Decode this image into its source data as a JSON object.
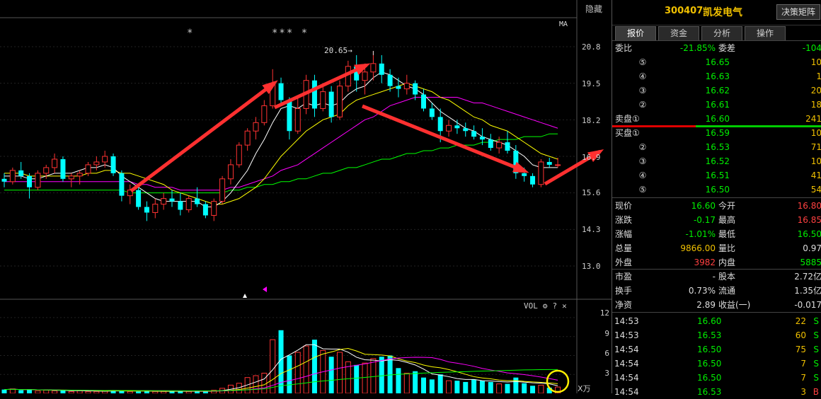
{
  "chart": {
    "hide_label": "隐藏",
    "ma_label": "MA",
    "high_label": "20.65→",
    "stars": [
      "*",
      "*** *"
    ],
    "price_ticks": [
      "20.8",
      "19.5",
      "18.2",
      "16.9",
      "15.6",
      "14.3",
      "13.0"
    ],
    "vol_toolbar": {
      "label": "VOL",
      "settings_icon": "gear-icon",
      "help": "?",
      "close": "✕"
    },
    "vol_ticks": [
      "12",
      "9",
      "6",
      "3"
    ],
    "vol_unit": "X万",
    "colors": {
      "up": "#ff3232",
      "down": "#00ffff",
      "ma5": "#ffffff",
      "ma10": "#ffff00",
      "ma20": "#ff00ff",
      "ma60": "#00ff00",
      "arrow": "#ff3030"
    }
  },
  "chart_data": {
    "type": "candlestick",
    "ylim": [
      13.0,
      20.8
    ],
    "candles": [
      [
        16.1,
        16.3,
        15.8,
        16.0
      ],
      [
        16.0,
        16.5,
        15.9,
        16.4
      ],
      [
        16.4,
        16.7,
        16.1,
        16.2
      ],
      [
        16.2,
        16.3,
        15.4,
        15.8
      ],
      [
        15.8,
        16.4,
        15.7,
        16.3
      ],
      [
        16.3,
        16.6,
        16.1,
        16.5
      ],
      [
        16.5,
        17.0,
        16.3,
        16.8
      ],
      [
        16.8,
        16.9,
        16.0,
        16.1
      ],
      [
        16.1,
        16.3,
        15.8,
        16.2
      ],
      [
        16.2,
        16.4,
        15.9,
        16.3
      ],
      [
        16.3,
        16.7,
        16.2,
        16.6
      ],
      [
        16.6,
        16.9,
        16.4,
        16.7
      ],
      [
        16.7,
        17.1,
        16.5,
        16.9
      ],
      [
        16.9,
        17.0,
        16.2,
        16.3
      ],
      [
        16.3,
        16.4,
        15.3,
        15.5
      ],
      [
        15.5,
        15.9,
        15.2,
        15.7
      ],
      [
        15.7,
        15.8,
        15.0,
        15.1
      ],
      [
        15.1,
        15.3,
        14.6,
        14.9
      ],
      [
        14.9,
        15.4,
        14.7,
        15.2
      ],
      [
        15.2,
        15.6,
        15.0,
        15.4
      ],
      [
        15.4,
        15.7,
        15.1,
        15.3
      ],
      [
        15.3,
        15.6,
        14.8,
        15.0
      ],
      [
        15.0,
        15.5,
        14.9,
        15.4
      ],
      [
        15.4,
        15.8,
        15.1,
        15.2
      ],
      [
        15.2,
        15.3,
        14.7,
        14.8
      ],
      [
        14.8,
        15.4,
        14.6,
        15.3
      ],
      [
        15.3,
        16.2,
        15.2,
        16.1
      ],
      [
        16.1,
        16.8,
        15.9,
        16.6
      ],
      [
        16.6,
        17.4,
        16.5,
        17.3
      ],
      [
        17.3,
        17.9,
        17.1,
        17.8
      ],
      [
        17.8,
        18.3,
        17.5,
        18.1
      ],
      [
        18.1,
        18.9,
        18.0,
        18.7
      ],
      [
        18.7,
        20.0,
        18.6,
        19.5
      ],
      [
        19.5,
        19.7,
        18.7,
        18.9
      ],
      [
        18.9,
        19.0,
        17.5,
        17.8
      ],
      [
        17.8,
        19.0,
        17.7,
        18.6
      ],
      [
        18.6,
        19.8,
        18.4,
        19.6
      ],
      [
        19.6,
        19.8,
        18.3,
        18.6
      ],
      [
        18.6,
        19.4,
        18.5,
        19.2
      ],
      [
        19.2,
        19.4,
        18.1,
        18.3
      ],
      [
        18.3,
        19.6,
        18.2,
        19.4
      ],
      [
        19.4,
        20.3,
        19.2,
        20.1
      ],
      [
        20.1,
        20.5,
        19.2,
        19.6
      ],
      [
        19.6,
        20.2,
        19.1,
        19.9
      ],
      [
        19.9,
        20.65,
        19.6,
        20.2
      ],
      [
        20.2,
        20.5,
        19.5,
        19.8
      ],
      [
        19.8,
        20.0,
        19.2,
        19.4
      ],
      [
        19.4,
        19.7,
        19.0,
        19.3
      ],
      [
        19.3,
        19.8,
        19.1,
        19.5
      ],
      [
        19.5,
        19.6,
        18.9,
        19.1
      ],
      [
        19.1,
        19.3,
        18.5,
        18.6
      ],
      [
        18.6,
        18.8,
        18.2,
        18.3
      ],
      [
        18.3,
        18.6,
        17.4,
        17.8
      ],
      [
        17.8,
        18.2,
        17.6,
        18.0
      ],
      [
        18.0,
        18.2,
        17.7,
        17.9
      ],
      [
        17.9,
        18.1,
        17.6,
        17.8
      ],
      [
        17.8,
        18.0,
        17.5,
        17.6
      ],
      [
        17.6,
        17.9,
        17.3,
        17.5
      ],
      [
        17.5,
        17.7,
        17.1,
        17.2
      ],
      [
        17.2,
        17.6,
        17.0,
        17.4
      ],
      [
        17.4,
        17.8,
        17.0,
        17.1
      ],
      [
        17.1,
        17.3,
        16.1,
        16.3
      ],
      [
        16.3,
        16.5,
        16.0,
        16.2
      ],
      [
        16.2,
        16.3,
        15.8,
        15.9
      ],
      [
        15.9,
        16.8,
        15.8,
        16.7
      ],
      [
        16.7,
        16.85,
        16.5,
        16.6
      ],
      [
        16.6,
        16.85,
        16.5,
        16.6
      ]
    ],
    "ma5": [
      16.2,
      16.2,
      16.2,
      16.1,
      16.1,
      16.2,
      16.3,
      16.3,
      16.3,
      16.4,
      16.5,
      16.5,
      16.6,
      16.5,
      16.2,
      16.0,
      15.8,
      15.6,
      15.4,
      15.3,
      15.3,
      15.3,
      15.3,
      15.3,
      15.1,
      15.1,
      15.3,
      15.6,
      16.0,
      16.4,
      17.0,
      17.5,
      18.1,
      18.6,
      18.7,
      18.6,
      18.8,
      18.7,
      18.8,
      18.7,
      18.8,
      19.1,
      19.3,
      19.4,
      19.7,
      19.9,
      19.8,
      19.6,
      19.4,
      19.3,
      19.1,
      18.8,
      18.5,
      18.3,
      18.1,
      17.9,
      17.8,
      17.6,
      17.5,
      17.4,
      17.3,
      17.1,
      16.9,
      16.6,
      16.5,
      16.5,
      16.5
    ],
    "ma10": [
      16.3,
      16.3,
      16.3,
      16.2,
      16.2,
      16.2,
      16.2,
      16.2,
      16.2,
      16.2,
      16.3,
      16.3,
      16.4,
      16.4,
      16.3,
      16.3,
      16.2,
      16.1,
      16.0,
      15.9,
      15.7,
      15.6,
      15.5,
      15.4,
      15.3,
      15.2,
      15.2,
      15.3,
      15.4,
      15.6,
      15.8,
      16.1,
      16.5,
      16.9,
      17.2,
      17.5,
      17.8,
      18.0,
      18.2,
      18.3,
      18.4,
      18.7,
      18.9,
      19.0,
      19.1,
      19.2,
      19.3,
      19.4,
      19.5,
      19.4,
      19.3,
      19.2,
      19.0,
      18.9,
      18.7,
      18.5,
      18.3,
      18.2,
      18.0,
      17.9,
      17.8,
      17.6,
      17.4,
      17.2,
      17.0,
      16.9,
      16.8
    ],
    "ma20": [
      16.0,
      16.0,
      16.0,
      16.0,
      16.0,
      16.0,
      16.0,
      16.0,
      16.0,
      16.0,
      16.0,
      16.0,
      16.0,
      16.0,
      16.0,
      16.0,
      15.9,
      15.9,
      15.8,
      15.8,
      15.8,
      15.7,
      15.7,
      15.7,
      15.7,
      15.7,
      15.7,
      15.8,
      15.8,
      15.9,
      16.0,
      16.1,
      16.2,
      16.4,
      16.5,
      16.6,
      16.8,
      17.0,
      17.2,
      17.4,
      17.6,
      17.8,
      18.0,
      18.2,
      18.3,
      18.5,
      18.7,
      18.8,
      18.9,
      19.0,
      19.0,
      19.0,
      19.0,
      19.0,
      19.0,
      18.9,
      18.8,
      18.8,
      18.7,
      18.6,
      18.5,
      18.4,
      18.3,
      18.2,
      18.1,
      18.0,
      17.9
    ],
    "ma60": [
      15.7,
      15.7,
      15.7,
      15.7,
      15.7,
      15.7,
      15.7,
      15.7,
      15.7,
      15.7,
      15.7,
      15.7,
      15.7,
      15.7,
      15.7,
      15.6,
      15.6,
      15.6,
      15.6,
      15.6,
      15.6,
      15.6,
      15.6,
      15.6,
      15.6,
      15.6,
      15.6,
      15.7,
      15.7,
      15.8,
      15.8,
      15.9,
      15.9,
      16.0,
      16.0,
      16.1,
      16.1,
      16.2,
      16.3,
      16.3,
      16.4,
      16.5,
      16.5,
      16.6,
      16.7,
      16.8,
      16.8,
      16.9,
      17.0,
      17.0,
      17.1,
      17.1,
      17.2,
      17.2,
      17.3,
      17.3,
      17.3,
      17.4,
      17.4,
      17.5,
      17.5,
      17.5,
      17.6,
      17.6,
      17.6,
      17.7,
      17.7
    ],
    "volume": [
      0.6,
      0.7,
      0.5,
      0.6,
      0.4,
      0.5,
      0.4,
      0.5,
      0.3,
      0.4,
      0.3,
      0.3,
      0.4,
      0.5,
      0.4,
      0.3,
      0.3,
      0.4,
      0.3,
      0.3,
      0.3,
      0.4,
      0.3,
      0.3,
      0.3,
      0.5,
      0.8,
      1.3,
      1.6,
      2.5,
      2.8,
      3.2,
      8.5,
      10.0,
      6.0,
      6.5,
      7.5,
      8.5,
      6.8,
      5.8,
      6.5,
      5.0,
      4.5,
      4.8,
      5.5,
      5.8,
      6.0,
      4.0,
      3.2,
      3.5,
      2.5,
      2.2,
      3.0,
      2.0,
      2.0,
      1.8,
      2.2,
      2.0,
      1.8,
      1.5,
      1.5,
      2.5,
      1.6,
      1.2,
      1.3,
      0.9,
      1.0
    ],
    "vol_ylim": [
      0,
      13
    ]
  },
  "panel": {
    "code": "300407",
    "name": "凯发电气",
    "decision_button": "决策矩阵",
    "tabs": [
      "报价",
      "资金",
      "分析",
      "操作"
    ],
    "commission_ratio": {
      "label": "委比",
      "value": "-21.85%",
      "label2": "委差",
      "value2": "-104"
    },
    "asks": [
      {
        "idx": "⑤",
        "price": "16.65",
        "vol": "10"
      },
      {
        "idx": "④",
        "price": "16.63",
        "vol": "1"
      },
      {
        "idx": "③",
        "price": "16.62",
        "vol": "20"
      },
      {
        "idx": "②",
        "price": "16.61",
        "vol": "18"
      },
      {
        "idx": "卖盘①",
        "price": "16.60",
        "vol": "241"
      }
    ],
    "bids": [
      {
        "idx": "买盘①",
        "price": "16.59",
        "vol": "10"
      },
      {
        "idx": "②",
        "price": "16.53",
        "vol": "71"
      },
      {
        "idx": "③",
        "price": "16.52",
        "vol": "10"
      },
      {
        "idx": "④",
        "price": "16.51",
        "vol": "41"
      },
      {
        "idx": "⑤",
        "price": "16.50",
        "vol": "54"
      }
    ],
    "stats": [
      {
        "l1": "现价",
        "v1": "16.60",
        "c1": "green",
        "l2": "今开",
        "v2": "16.80",
        "c2": "red"
      },
      {
        "l1": "涨跌",
        "v1": "-0.17",
        "c1": "green",
        "l2": "最高",
        "v2": "16.85",
        "c2": "red"
      },
      {
        "l1": "涨幅",
        "v1": "-1.01%",
        "c1": "green",
        "l2": "最低",
        "v2": "16.50",
        "c2": "green"
      },
      {
        "l1": "总量",
        "v1": "9866.00",
        "c1": "yellow",
        "l2": "量比",
        "v2": "0.97",
        "c2": "white"
      },
      {
        "l1": "外盘",
        "v1": "3982",
        "c1": "red",
        "l2": "内盘",
        "v2": "5885",
        "c2": "green"
      }
    ],
    "fund": [
      {
        "l1": "市盈",
        "v1": "-",
        "l2": "股本",
        "v2": "2.72亿"
      },
      {
        "l1": "换手",
        "v1": "0.73%",
        "l2": "流通",
        "v2": "1.35亿"
      },
      {
        "l1": "净资",
        "v1": "2.89",
        "l2": "收益(一)",
        "v2": "-0.017"
      }
    ],
    "ticks": [
      {
        "time": "14:53",
        "price": "16.60",
        "vol": "22",
        "flag": "S"
      },
      {
        "time": "14:53",
        "price": "16.53",
        "vol": "60",
        "flag": "S"
      },
      {
        "time": "14:54",
        "price": "16.50",
        "vol": "75",
        "flag": "S"
      },
      {
        "time": "14:54",
        "price": "16.50",
        "vol": "7",
        "flag": "S"
      },
      {
        "time": "14:54",
        "price": "16.50",
        "vol": "7",
        "flag": "S"
      },
      {
        "time": "14:54",
        "price": "16.53",
        "vol": "3",
        "flag": "B"
      }
    ]
  }
}
